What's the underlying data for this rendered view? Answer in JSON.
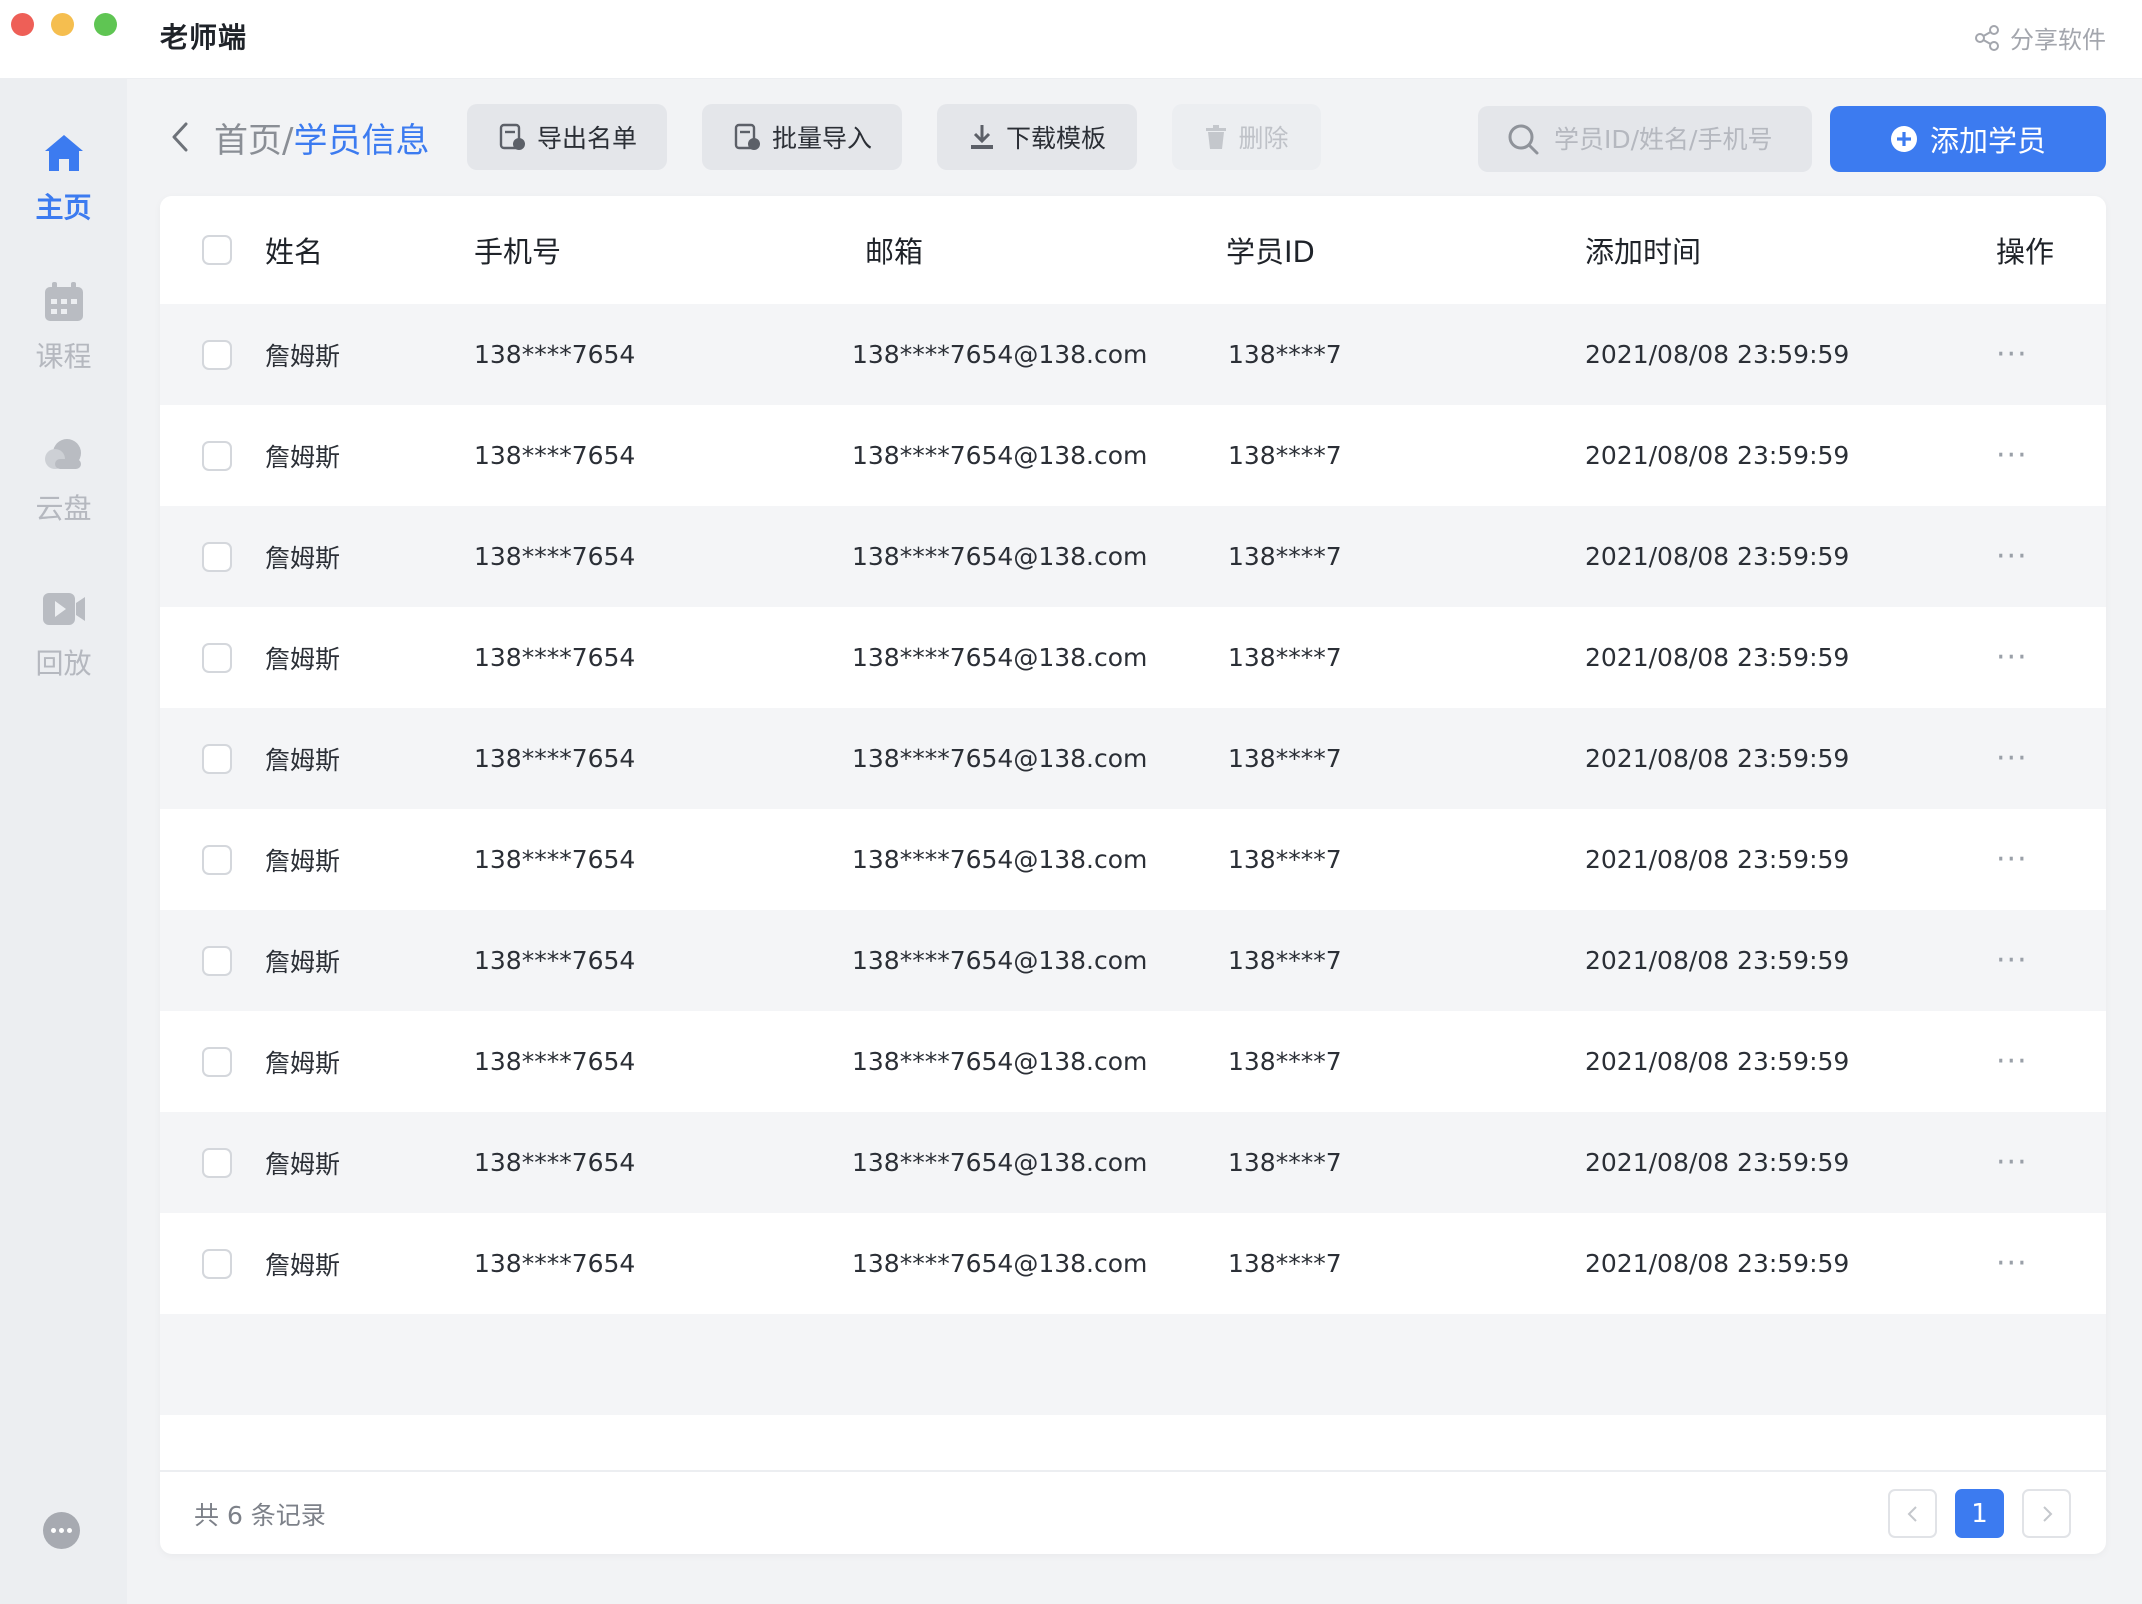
{
  "app": {
    "title": "老师端",
    "share_label": "分享软件"
  },
  "sidebar": {
    "items": [
      {
        "label": "主页",
        "icon": "home-icon",
        "active": true
      },
      {
        "label": "课程",
        "icon": "calendar-icon"
      },
      {
        "label": "云盘",
        "icon": "cloud-icon"
      },
      {
        "label": "回放",
        "icon": "video-icon"
      }
    ],
    "chat_icon": "chat-bubble-icon"
  },
  "breadcrumb": {
    "home": "首页",
    "separator": "/",
    "current": "学员信息"
  },
  "toolbar": {
    "export_label": "导出名单",
    "import_label": "批量导入",
    "template_label": "下载模板",
    "delete_label": "删除",
    "add_label": "添加学员"
  },
  "search": {
    "placeholder": "学员ID/姓名/手机号",
    "value": ""
  },
  "table": {
    "columns": [
      "姓名",
      "手机号",
      "邮箱",
      "学员ID",
      "添加时间",
      "操作"
    ],
    "rows": [
      {
        "name": "詹姆斯",
        "phone": "138****7654",
        "email": "138****7654@138.com",
        "id": "138****7",
        "time": "2021/08/08 23:59:59",
        "op": "···"
      },
      {
        "name": "詹姆斯",
        "phone": "138****7654",
        "email": "138****7654@138.com",
        "id": "138****7",
        "time": "2021/08/08 23:59:59",
        "op": "···"
      },
      {
        "name": "詹姆斯",
        "phone": "138****7654",
        "email": "138****7654@138.com",
        "id": "138****7",
        "time": "2021/08/08 23:59:59",
        "op": "···"
      },
      {
        "name": "詹姆斯",
        "phone": "138****7654",
        "email": "138****7654@138.com",
        "id": "138****7",
        "time": "2021/08/08 23:59:59",
        "op": "···"
      },
      {
        "name": "詹姆斯",
        "phone": "138****7654",
        "email": "138****7654@138.com",
        "id": "138****7",
        "time": "2021/08/08 23:59:59",
        "op": "···"
      },
      {
        "name": "詹姆斯",
        "phone": "138****7654",
        "email": "138****7654@138.com",
        "id": "138****7",
        "time": "2021/08/08 23:59:59",
        "op": "···"
      },
      {
        "name": "詹姆斯",
        "phone": "138****7654",
        "email": "138****7654@138.com",
        "id": "138****7",
        "time": "2021/08/08 23:59:59",
        "op": "···"
      },
      {
        "name": "詹姆斯",
        "phone": "138****7654",
        "email": "138****7654@138.com",
        "id": "138****7",
        "time": "2021/08/08 23:59:59",
        "op": "···"
      },
      {
        "name": "詹姆斯",
        "phone": "138****7654",
        "email": "138****7654@138.com",
        "id": "138****7",
        "time": "2021/08/08 23:59:59",
        "op": "···"
      },
      {
        "name": "詹姆斯",
        "phone": "138****7654",
        "email": "138****7654@138.com",
        "id": "138****7",
        "time": "2021/08/08 23:59:59",
        "op": "···"
      }
    ]
  },
  "pagination": {
    "total_text": "共 6 条记录",
    "current_page": "1"
  },
  "colors": {
    "accent": "#3c7bf0",
    "stripe": "#f4f5f7",
    "sidebar_bg": "#eceef1"
  }
}
